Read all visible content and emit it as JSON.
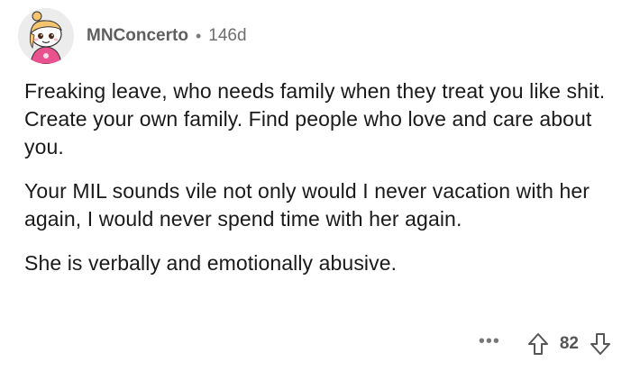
{
  "comment": {
    "username": "MNConcerto",
    "separator": "•",
    "age": "146d",
    "paragraphs": [
      "Freaking leave, who needs family when they treat you like shit. Create your own family. Find people who love and care about you.",
      "Your MIL sounds vile not only would I never vacation with her again, I would never spend time with her again.",
      "She is verbally and emotionally abusive."
    ],
    "more_label": "•••",
    "vote_count": "82"
  },
  "icons": {
    "avatar": "snoo-avatar-icon",
    "upvote": "upvote-arrow-icon",
    "downvote": "downvote-arrow-icon",
    "more": "more-options-icon"
  },
  "colors": {
    "text": "#1a1a1a",
    "meta": "#6e6e6e",
    "avatar_shirt": "#e8528f"
  }
}
